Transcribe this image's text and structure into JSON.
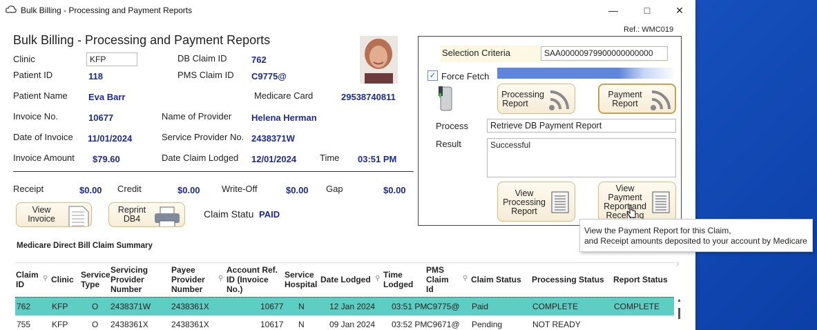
{
  "window": {
    "title": "Bulk Billing - Processing and Payment Reports",
    "ref": "Ref.: WMC019"
  },
  "page_title": "Bulk Billing - Processing and Payment Reports",
  "patient": {
    "clinic_label": "Clinic",
    "clinic_value": "KFP",
    "db_claim_id_label": "DB Claim ID",
    "db_claim_id_value": "762",
    "patient_id_label": "Patient ID",
    "patient_id_value": "118",
    "pms_claim_id_label": "PMS Claim ID",
    "pms_claim_id_value": "C9775@",
    "patient_name_label": "Patient Name",
    "patient_name_value": "Eva Barr",
    "medicare_card_label": "Medicare Card",
    "medicare_card_value": "29538740811",
    "invoice_no_label": "Invoice No.",
    "invoice_no_value": "10677",
    "provider_name_label": "Name of Provider",
    "provider_name_value": "Helena Herman",
    "invoice_date_label": "Date of Invoice",
    "invoice_date_value": "11/01/2024",
    "service_provider_label": "Service Provider No.",
    "service_provider_value": "2438371W",
    "invoice_amount_label": "Invoice Amount",
    "invoice_amount_value": "$79.60",
    "date_lodged_label": "Date Claim Lodged",
    "date_lodged_value": "12/01/2024",
    "time_label": "Time",
    "time_value": "03:51 PM"
  },
  "totals": {
    "receipt_label": "Receipt",
    "receipt_value": "$0.00",
    "credit_label": "Credit",
    "credit_value": "$0.00",
    "writeoff_label": "Write-Off",
    "writeoff_value": "$0.00",
    "gap_label": "Gap",
    "gap_value": "$0.00"
  },
  "buttons": {
    "view_invoice": [
      "View",
      "Invoice"
    ],
    "reprint_db4": [
      "Reprint",
      "DB4"
    ],
    "processing_report": [
      "Processing",
      "Report"
    ],
    "payment_report": [
      "Payment",
      "Report"
    ],
    "view_processing_report": [
      "View",
      "Processing",
      "Report"
    ],
    "view_payment_report": [
      "View",
      "Payment",
      "Report and",
      "Receiving"
    ]
  },
  "claim_status": {
    "label": "Claim Statu",
    "value": "PAID"
  },
  "panel": {
    "selection_label": "Selection Criteria",
    "selection_value": "SAA00000979900000000000",
    "force_fetch_label": "Force Fetch",
    "force_fetch_checked": true,
    "process_label": "Process",
    "process_value": "Retrieve DB Payment Report",
    "result_label": "Result",
    "result_value": "Successful"
  },
  "tooltip": {
    "line1": "View the Payment Report for this Claim,",
    "line2": "and Receipt amounts deposited to your account by Medicare"
  },
  "summary": {
    "title": "Medicare Direct Bill Claim Summary",
    "columns": [
      "Claim ID",
      "Clinic",
      "Service Type",
      "Servicing Provider Number",
      "Payee Provider Number",
      "Account Ref. ID (Invoice No.)",
      "Service Hospital",
      "Date Lodged",
      "Time Lodged",
      "PMS Claim Id",
      "Claim Status",
      "Processing Status",
      "Report Status"
    ],
    "rows": [
      [
        "762",
        "KFP",
        "O",
        "2438371W",
        "2438361X",
        "10677",
        "N",
        "12 Jan 2024",
        "03:51 PM",
        "C9775@",
        "Paid",
        "COMPLETE",
        "COMPLETE"
      ],
      [
        "755",
        "KFP",
        "O",
        "2438361X",
        "2438361X",
        "10617",
        "N",
        "09 Jan 2024",
        "03:52 PM",
        "C9671@",
        "Pending",
        "NOT READY",
        ""
      ]
    ],
    "selected_row": 0
  },
  "colors": {
    "accent_value": "#1a2a9e",
    "selected_row": "#5ecdc4",
    "button_border": "#d9b978",
    "desktop": "#1a57c4"
  }
}
